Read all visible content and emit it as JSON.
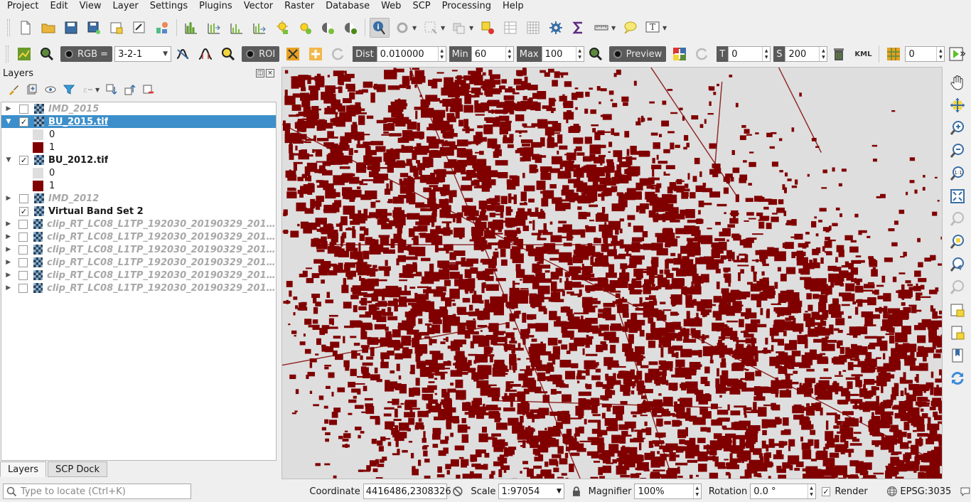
{
  "menu": [
    "Project",
    "Edit",
    "View",
    "Layer",
    "Settings",
    "Plugins",
    "Vector",
    "Raster",
    "Database",
    "Web",
    "SCP",
    "Processing",
    "Help"
  ],
  "scp_toolbar": {
    "rgb_label": "RGB =",
    "rgb_value": "3-2-1",
    "roi_label": "ROI",
    "dist_label": "Dist",
    "dist_value": "0.010000",
    "min_label": "Min",
    "min_value": "60",
    "max_label": "Max",
    "max_value": "100",
    "preview_label": "Preview",
    "t_label": "T",
    "t_value": "0",
    "s_label": "S",
    "s_value": "200",
    "kml_label": "KML",
    "band_value": "0",
    "overflow": "»"
  },
  "layers_panel": {
    "title": "Layers",
    "float_btn": "◫",
    "close_btn": "×",
    "layers": [
      {
        "name": "IMD_2015",
        "checked": false,
        "expanded": false
      },
      {
        "name": "BU_2015.tif",
        "checked": true,
        "expanded": true,
        "selected": true
      },
      {
        "name": "BU_2012.tif",
        "checked": true,
        "expanded": true
      },
      {
        "name": "IMD_2012",
        "checked": false,
        "expanded": false
      },
      {
        "name": "Virtual Band Set 2",
        "checked": true,
        "expanded": false
      },
      {
        "name": "clip_RT_LC08_L1TP_192030_20190329_20190...",
        "checked": false,
        "expanded": false
      },
      {
        "name": "clip_RT_LC08_L1TP_192030_20190329_20190...",
        "checked": false,
        "expanded": false
      },
      {
        "name": "clip_RT_LC08_L1TP_192030_20190329_20190...",
        "checked": false,
        "expanded": false
      },
      {
        "name": "clip_RT_LC08_L1TP_192030_20190329_20190...",
        "checked": false,
        "expanded": false
      },
      {
        "name": "clip_RT_LC08_L1TP_192030_20190329_20190...",
        "checked": false,
        "expanded": false
      },
      {
        "name": "clip_RT_LC08_L1TP_192030_20190329_20190...",
        "checked": false,
        "expanded": false
      }
    ],
    "legend": {
      "class0": "0",
      "class1": "1"
    },
    "tabs": [
      "Layers",
      "SCP Dock"
    ]
  },
  "colors": {
    "built_up": "#800000",
    "non_built": "#dedede",
    "selection": "#3c8fca"
  },
  "statusbar": {
    "locator_placeholder": "Type to locate (Ctrl+K)",
    "coordinate_label": "Coordinate",
    "coordinate_value": "4416486,2308326",
    "scale_label": "Scale",
    "scale_value": "1:97054",
    "magnifier_label": "Magnifier",
    "magnifier_value": "100%",
    "rotation_label": "Rotation",
    "rotation_value": "0.0 °",
    "render_label": "Render",
    "crs_label": "EPSG:3035"
  }
}
